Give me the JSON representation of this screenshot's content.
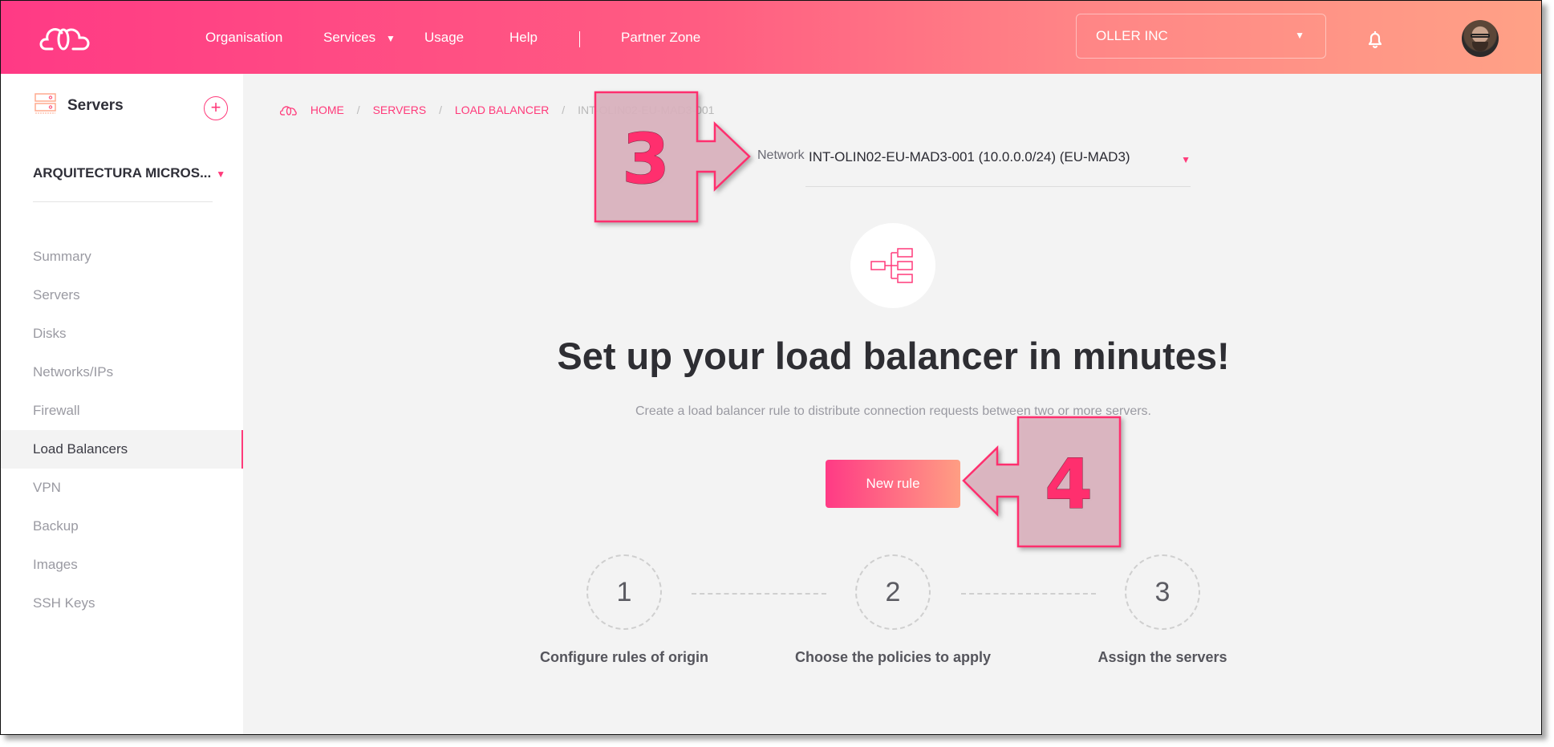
{
  "header": {
    "nav": [
      "Organisation",
      "Services",
      "Usage",
      "Help",
      "Partner Zone"
    ],
    "org_selector": "OLLER INC",
    "icons": {
      "logo": "cloud-logo-icon",
      "services_arrow": "caret-down-icon",
      "notifications": "bell-icon",
      "profile": "avatar"
    }
  },
  "sidebar": {
    "title": "Servers",
    "add_label": "+",
    "project": "ARQUITECTURA MICROS...",
    "items": [
      {
        "label": "Summary",
        "active": false
      },
      {
        "label": "Servers",
        "active": false
      },
      {
        "label": "Disks",
        "active": false
      },
      {
        "label": "Networks/IPs",
        "active": false
      },
      {
        "label": "Firewall",
        "active": false
      },
      {
        "label": "Load Balancers",
        "active": true
      },
      {
        "label": "VPN",
        "active": false
      },
      {
        "label": "Backup",
        "active": false
      },
      {
        "label": "Images",
        "active": false
      },
      {
        "label": "SSH Keys",
        "active": false
      }
    ]
  },
  "breadcrumb": {
    "items": [
      "HOME",
      "SERVERS",
      "LOAD BALANCER"
    ],
    "separator": "/",
    "current": "INT-OLIN02-EU-MAD3-001"
  },
  "network": {
    "label": "Network",
    "value": "INT-OLIN02-EU-MAD3-001 (10.0.0.0/24) (EU-MAD3)"
  },
  "hero": {
    "title": "Set up your load balancer in minutes!",
    "subtitle": "Create a load balancer rule to distribute connection requests between two or more servers.",
    "button": "New rule"
  },
  "steps": [
    {
      "number": "1",
      "label": "Configure rules of origin"
    },
    {
      "number": "2",
      "label": "Choose the policies to apply"
    },
    {
      "number": "3",
      "label": "Assign the servers"
    }
  ],
  "annotations": [
    {
      "number": "3",
      "points_to": "network-select"
    },
    {
      "number": "4",
      "points_to": "new-rule-button"
    }
  ],
  "colors": {
    "accent": "#ff3a7a",
    "header_gradient_start": "#ff3a85",
    "header_gradient_end": "#ffa186",
    "callout_fill": "#dcb4c0",
    "callout_stroke": "#ff2f6e"
  }
}
